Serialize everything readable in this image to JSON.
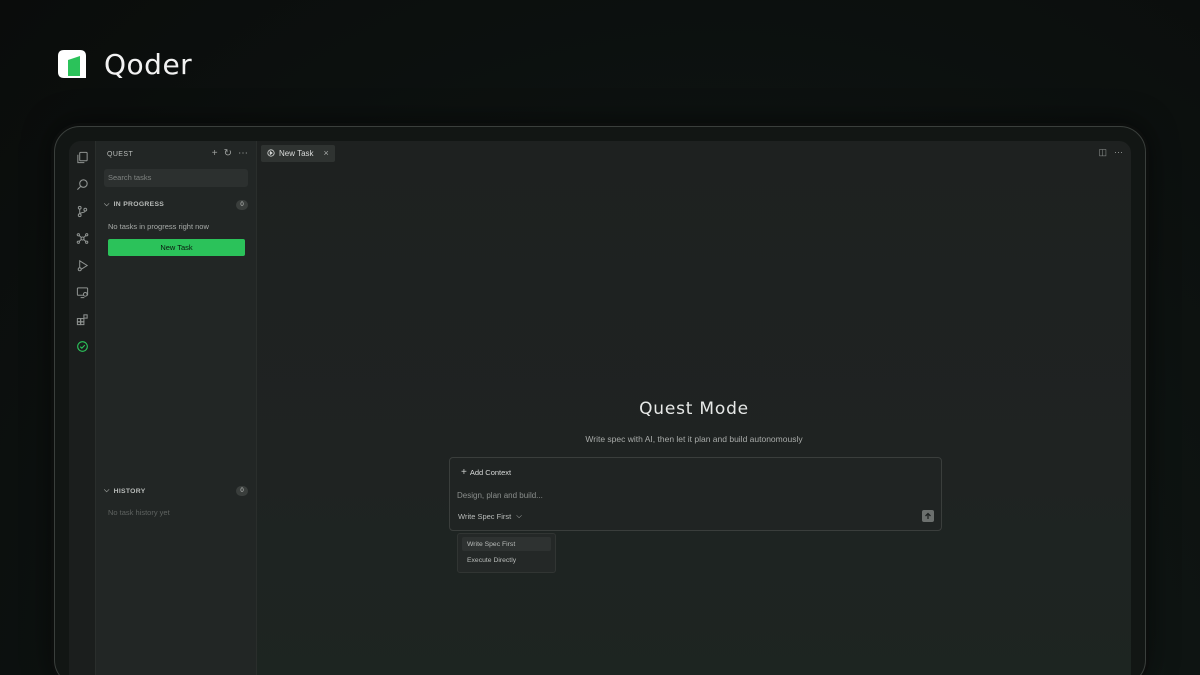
{
  "brand": {
    "name": "Qoder",
    "accent": "#2bc25a"
  },
  "activity_bar": {
    "icons": [
      "explorer-icon",
      "search-icon",
      "source-control-icon",
      "extensions-network-icon",
      "run-debug-icon",
      "remote-explorer-icon",
      "extensions-icon",
      "quest-check-icon"
    ],
    "active": "quest-check-icon"
  },
  "sidebar": {
    "title": "QUEST",
    "actions": {
      "add": "+",
      "refresh": "↻",
      "more": "⋯"
    },
    "search_placeholder": "Search tasks",
    "in_progress": {
      "label": "IN PROGRESS",
      "count": "0",
      "empty_text": "No tasks in progress right now",
      "button_label": "New Task"
    },
    "history": {
      "label": "HISTORY",
      "count": "0",
      "empty_text": "No task history yet"
    }
  },
  "tabs": [
    {
      "label": "New Task",
      "close": "×"
    }
  ],
  "tab_actions": {
    "split": "◫",
    "more": "⋯"
  },
  "main": {
    "title": "Quest Mode",
    "subtitle": "Write spec with AI, then let it plan and build autonomously",
    "composer": {
      "add_context_label": "Add Context",
      "input_placeholder": "Design, plan and build...",
      "mode_selected": "Write Spec First",
      "mode_chevron": "⌵",
      "send_icon": "arrow-up-icon"
    },
    "dropdown_options": [
      "Write Spec First",
      "Execute Directly"
    ]
  }
}
